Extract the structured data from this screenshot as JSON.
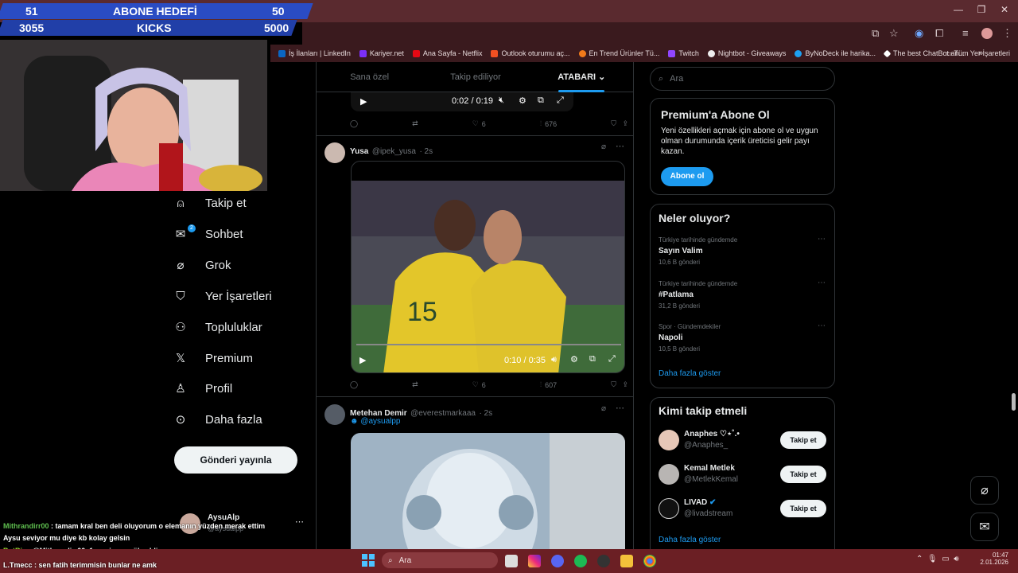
{
  "stream": {
    "goal_left_value": "51",
    "goal_label": "ABONE HEDEFİ",
    "goal_right_value": "50",
    "kicks_left_value": "3055",
    "kicks_label": "KICKS",
    "kicks_right_value": "5000"
  },
  "bookmarks": [
    {
      "label": "İş İlanları | LinkedIn",
      "color": "#0a66c2"
    },
    {
      "label": "Kariyer.net",
      "color": "#7b2ff7"
    },
    {
      "label": "Ana Sayfa - Netflix",
      "color": "#e50914"
    },
    {
      "label": "Outlook oturumu aç...",
      "color": "#f25022"
    },
    {
      "label": "En Trend Ürünler Tü...",
      "color": "#f27a1a"
    },
    {
      "label": "Twitch",
      "color": "#9146ff"
    },
    {
      "label": "Nightbot - Giveaways",
      "color": "#eeeeee"
    },
    {
      "label": "ByNoDeck ile harika...",
      "color": "#1da1f2"
    },
    {
      "label": "The best ChatBot an...",
      "color": "#ffffff"
    }
  ],
  "all_bookmarks": "Tüm Yer İşaretleri",
  "nav": {
    "follow": "Takip et",
    "chat": "Sohbet",
    "chat_badge": "2",
    "grok": "Grok",
    "bookmarks": "Yer İşaretleri",
    "communities": "Topluluklar",
    "premium": "Premium",
    "profile": "Profil",
    "more": "Daha fazla",
    "post_button": "Gönderi yayınla",
    "account_name": "AysuAlp",
    "account_handle": "@aysualpp"
  },
  "feed": {
    "tabs": [
      "Sana özel",
      "Takip ediliyor",
      "ATABARI"
    ],
    "post0": {
      "time": "0:02 / 0:19",
      "likes": "6",
      "views": "676"
    },
    "post1": {
      "name": "Yusa",
      "handle": "@ipek_yusa",
      "time_ago": "· 2s",
      "video_time": "0:10 / 0:35",
      "likes": "6",
      "views": "607"
    },
    "post2": {
      "name": "Metehan Demir",
      "handle": "@everestmarkaaa",
      "time_ago": "· 2s",
      "mention": "@aysualpp"
    }
  },
  "sidebar": {
    "search_placeholder": "Ara",
    "premium": {
      "title": "Premium'a Abone Ol",
      "body": "Yeni özellikleri açmak için abone ol ve uygun olman durumunda içerik üreticisi gelir payı kazan.",
      "button": "Abone ol"
    },
    "trends": {
      "title": "Neler oluyor?",
      "items": [
        {
          "meta": "Türkiye tarihinde gündemde",
          "name": "Sayın Valim",
          "count": "10,6 B gönderi"
        },
        {
          "meta": "Türkiye tarihinde gündemde",
          "name": "#Patlama",
          "count": "31,2 B gönderi"
        },
        {
          "meta": "Spor · Gündemdekiler",
          "name": "Napoli",
          "count": "10,5 B gönderi"
        }
      ],
      "show_more": "Daha fazla göster"
    },
    "who_to_follow": {
      "title": "Kimi takip etmeli",
      "items": [
        {
          "name": "Anaphes ♡⋆˚.•",
          "handle": "@Anaphes_",
          "button": "Takip et"
        },
        {
          "name": "Kemal Metlek",
          "handle": "@MetlekKemal",
          "button": "Takip et"
        },
        {
          "name": "LIVAD",
          "handle": "@livadstream",
          "button": "Takip et"
        }
      ],
      "show_more": "Daha fazla göster"
    }
  },
  "chat": [
    {
      "user": "Mithrandirr00",
      "text": " : tamam kral ben deli oluyorum o elemanın yüzden merak ettim",
      "color": "#5fbf4f"
    },
    {
      "user": "",
      "text": "Aysu seviyor mu diye kb kolay gelsin",
      "color": "#ffffff"
    },
    {
      "user": "BotRix",
      "text": " : @Mithrandirr00, 1. seviyeye yükseldin",
      "color": "#a3e635"
    },
    {
      "user": "L.Tmecc",
      "text": " : sen fatih terimmisin bunlar ne amk",
      "color": "#ffffff"
    }
  ],
  "taskbar": {
    "search": "Ara",
    "time": "01:47",
    "date": "2.01.2026"
  }
}
